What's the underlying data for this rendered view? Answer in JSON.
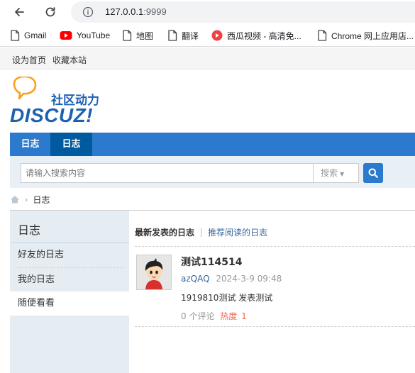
{
  "browser": {
    "url_host": "127.0.0.1",
    "url_port": ":9999",
    "bookmarks": [
      {
        "label": "Gmail",
        "icon": "gmail-icon"
      },
      {
        "label": "YouTube",
        "icon": "youtube-icon"
      },
      {
        "label": "地图",
        "icon": "file-icon"
      },
      {
        "label": "翻译",
        "icon": "file-icon"
      },
      {
        "label": "西瓜视频 - 高清免...",
        "icon": "xigua-icon"
      },
      {
        "label": "Chrome 网上应用店...",
        "icon": "file-icon"
      }
    ]
  },
  "site_top": {
    "set_home": "设为首页",
    "bookmark_site": "收藏本站"
  },
  "logo": {
    "slogan": "社区动力",
    "brand": "DISCUZ!"
  },
  "nav": {
    "items": [
      "日志",
      "日志"
    ],
    "active_index": 1
  },
  "search": {
    "placeholder": "请输入搜索内容",
    "type_label": "搜索"
  },
  "breadcrumb": {
    "current": "日志"
  },
  "sidebar": {
    "title": "日志",
    "items": [
      "好友的日志",
      "我的日志",
      "随便看看"
    ],
    "current_index": 2
  },
  "content": {
    "tabs": [
      "最新发表的日志",
      "推荐阅读的日志"
    ],
    "post": {
      "title": "测试114514",
      "author": "azQAQ",
      "date": "2024-3-9 09:48",
      "summary": "1919810测试 发表测试",
      "comments": "0 个评论",
      "heat_label": "热度",
      "heat_value": "1"
    }
  },
  "colors": {
    "nav_blue": "#2b7acd",
    "nav_active": "#005aa0",
    "link": "#336699",
    "heat": "#f26c4f"
  }
}
